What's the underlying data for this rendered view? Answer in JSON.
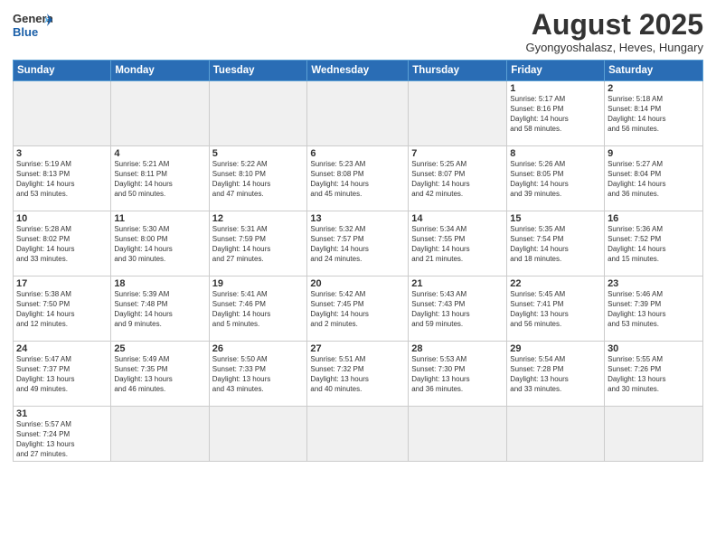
{
  "header": {
    "logo_general": "General",
    "logo_blue": "Blue",
    "main_title": "August 2025",
    "sub_title": "Gyongyoshalasz, Heves, Hungary"
  },
  "days_of_week": [
    "Sunday",
    "Monday",
    "Tuesday",
    "Wednesday",
    "Thursday",
    "Friday",
    "Saturday"
  ],
  "weeks": [
    [
      {
        "day": "",
        "info": "",
        "empty": true
      },
      {
        "day": "",
        "info": "",
        "empty": true
      },
      {
        "day": "",
        "info": "",
        "empty": true
      },
      {
        "day": "",
        "info": "",
        "empty": true
      },
      {
        "day": "",
        "info": "",
        "empty": true
      },
      {
        "day": "1",
        "info": "Sunrise: 5:17 AM\nSunset: 8:16 PM\nDaylight: 14 hours\nand 58 minutes."
      },
      {
        "day": "2",
        "info": "Sunrise: 5:18 AM\nSunset: 8:14 PM\nDaylight: 14 hours\nand 56 minutes."
      }
    ],
    [
      {
        "day": "3",
        "info": "Sunrise: 5:19 AM\nSunset: 8:13 PM\nDaylight: 14 hours\nand 53 minutes."
      },
      {
        "day": "4",
        "info": "Sunrise: 5:21 AM\nSunset: 8:11 PM\nDaylight: 14 hours\nand 50 minutes."
      },
      {
        "day": "5",
        "info": "Sunrise: 5:22 AM\nSunset: 8:10 PM\nDaylight: 14 hours\nand 47 minutes."
      },
      {
        "day": "6",
        "info": "Sunrise: 5:23 AM\nSunset: 8:08 PM\nDaylight: 14 hours\nand 45 minutes."
      },
      {
        "day": "7",
        "info": "Sunrise: 5:25 AM\nSunset: 8:07 PM\nDaylight: 14 hours\nand 42 minutes."
      },
      {
        "day": "8",
        "info": "Sunrise: 5:26 AM\nSunset: 8:05 PM\nDaylight: 14 hours\nand 39 minutes."
      },
      {
        "day": "9",
        "info": "Sunrise: 5:27 AM\nSunset: 8:04 PM\nDaylight: 14 hours\nand 36 minutes."
      }
    ],
    [
      {
        "day": "10",
        "info": "Sunrise: 5:28 AM\nSunset: 8:02 PM\nDaylight: 14 hours\nand 33 minutes."
      },
      {
        "day": "11",
        "info": "Sunrise: 5:30 AM\nSunset: 8:00 PM\nDaylight: 14 hours\nand 30 minutes."
      },
      {
        "day": "12",
        "info": "Sunrise: 5:31 AM\nSunset: 7:59 PM\nDaylight: 14 hours\nand 27 minutes."
      },
      {
        "day": "13",
        "info": "Sunrise: 5:32 AM\nSunset: 7:57 PM\nDaylight: 14 hours\nand 24 minutes."
      },
      {
        "day": "14",
        "info": "Sunrise: 5:34 AM\nSunset: 7:55 PM\nDaylight: 14 hours\nand 21 minutes."
      },
      {
        "day": "15",
        "info": "Sunrise: 5:35 AM\nSunset: 7:54 PM\nDaylight: 14 hours\nand 18 minutes."
      },
      {
        "day": "16",
        "info": "Sunrise: 5:36 AM\nSunset: 7:52 PM\nDaylight: 14 hours\nand 15 minutes."
      }
    ],
    [
      {
        "day": "17",
        "info": "Sunrise: 5:38 AM\nSunset: 7:50 PM\nDaylight: 14 hours\nand 12 minutes."
      },
      {
        "day": "18",
        "info": "Sunrise: 5:39 AM\nSunset: 7:48 PM\nDaylight: 14 hours\nand 9 minutes."
      },
      {
        "day": "19",
        "info": "Sunrise: 5:41 AM\nSunset: 7:46 PM\nDaylight: 14 hours\nand 5 minutes."
      },
      {
        "day": "20",
        "info": "Sunrise: 5:42 AM\nSunset: 7:45 PM\nDaylight: 14 hours\nand 2 minutes."
      },
      {
        "day": "21",
        "info": "Sunrise: 5:43 AM\nSunset: 7:43 PM\nDaylight: 13 hours\nand 59 minutes."
      },
      {
        "day": "22",
        "info": "Sunrise: 5:45 AM\nSunset: 7:41 PM\nDaylight: 13 hours\nand 56 minutes."
      },
      {
        "day": "23",
        "info": "Sunrise: 5:46 AM\nSunset: 7:39 PM\nDaylight: 13 hours\nand 53 minutes."
      }
    ],
    [
      {
        "day": "24",
        "info": "Sunrise: 5:47 AM\nSunset: 7:37 PM\nDaylight: 13 hours\nand 49 minutes."
      },
      {
        "day": "25",
        "info": "Sunrise: 5:49 AM\nSunset: 7:35 PM\nDaylight: 13 hours\nand 46 minutes."
      },
      {
        "day": "26",
        "info": "Sunrise: 5:50 AM\nSunset: 7:33 PM\nDaylight: 13 hours\nand 43 minutes."
      },
      {
        "day": "27",
        "info": "Sunrise: 5:51 AM\nSunset: 7:32 PM\nDaylight: 13 hours\nand 40 minutes."
      },
      {
        "day": "28",
        "info": "Sunrise: 5:53 AM\nSunset: 7:30 PM\nDaylight: 13 hours\nand 36 minutes."
      },
      {
        "day": "29",
        "info": "Sunrise: 5:54 AM\nSunset: 7:28 PM\nDaylight: 13 hours\nand 33 minutes."
      },
      {
        "day": "30",
        "info": "Sunrise: 5:55 AM\nSunset: 7:26 PM\nDaylight: 13 hours\nand 30 minutes."
      }
    ],
    [
      {
        "day": "31",
        "info": "Sunrise: 5:57 AM\nSunset: 7:24 PM\nDaylight: 13 hours\nand 27 minutes.",
        "last": true
      },
      {
        "day": "",
        "info": "",
        "empty": true,
        "last": true
      },
      {
        "day": "",
        "info": "",
        "empty": true,
        "last": true
      },
      {
        "day": "",
        "info": "",
        "empty": true,
        "last": true
      },
      {
        "day": "",
        "info": "",
        "empty": true,
        "last": true
      },
      {
        "day": "",
        "info": "",
        "empty": true,
        "last": true
      },
      {
        "day": "",
        "info": "",
        "empty": true,
        "last": true
      }
    ]
  ]
}
